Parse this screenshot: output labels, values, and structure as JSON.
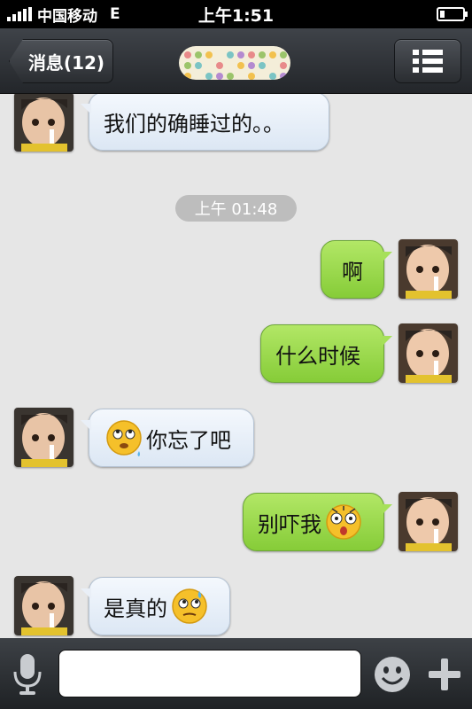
{
  "status_bar": {
    "carrier": "中国移动",
    "network": "E",
    "time": "上午1:51"
  },
  "nav": {
    "back_label": "消息(12)",
    "menu_icon": "list-icon"
  },
  "chat": {
    "time_separator": "上午 01:48",
    "messages": [
      {
        "direction": "incoming",
        "text": "我们的确睡过的。。"
      },
      {
        "direction": "outgoing",
        "text": "啊"
      },
      {
        "direction": "outgoing",
        "text": "什么时候"
      },
      {
        "direction": "incoming",
        "text": "你忘了吧",
        "emoji_before": "sweat-roll-eyes-emoji"
      },
      {
        "direction": "outgoing",
        "text": "别吓我",
        "emoji_after": "shocked-emoji"
      },
      {
        "direction": "incoming",
        "text": "是真的",
        "emoji_after": "sweat-emoji"
      }
    ]
  },
  "input_bar": {
    "value": "",
    "icons": [
      "microphone-icon",
      "smiley-icon",
      "plus-icon"
    ]
  },
  "colors": {
    "incoming_bubble": "#e3ecf7",
    "outgoing_bubble": "#9edb52",
    "nav_bar": "#2f3237"
  }
}
